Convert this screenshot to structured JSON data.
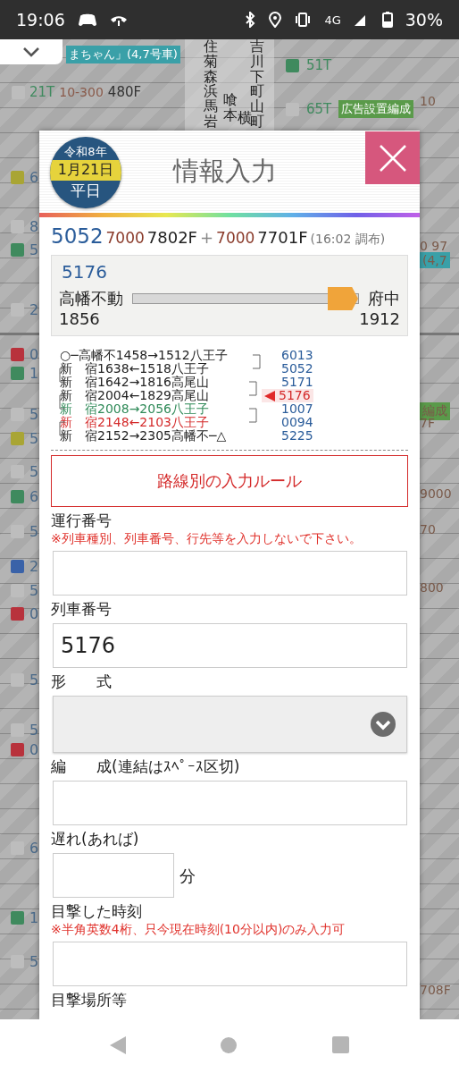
{
  "status_bar": {
    "time": "19:06",
    "network": "4G",
    "battery": "30%"
  },
  "background": {
    "top_badge": "まちゃん」(4,7号車)",
    "rows": [
      {
        "color": "#bdbdbd",
        "train": "21T",
        "series": "10-300",
        "formation": "480F"
      }
    ],
    "right_trains": [
      {
        "color": "#3f8a5e",
        "train": "51T"
      },
      {
        "color": "#bdbdbd",
        "train": "65T",
        "badge": "広告設置編成"
      }
    ],
    "station_columns": [
      "住菊森浜馬岩",
      "喰本",
      "横",
      "吉川下町山町"
    ],
    "left_marks": [
      {
        "color": "#a9a534",
        "text": "6"
      },
      {
        "color": "#bdbdbd",
        "text": "8"
      },
      {
        "color": "#3f8a5e",
        "text": "5"
      },
      {
        "color": "#bdbdbd",
        "text": "2"
      },
      {
        "color": "#b8323c",
        "text": "0"
      },
      {
        "color": "#3f8a5e",
        "text": "1"
      },
      {
        "color": "#bdbdbd",
        "text": "5"
      },
      {
        "color": "#a9a534",
        "text": "5"
      },
      {
        "color": "#bdbdbd",
        "text": "5"
      },
      {
        "color": "#3f8a5e",
        "text": "6"
      },
      {
        "color": "#bdbdbd",
        "text": "5"
      },
      {
        "color": "#3a62a8",
        "text": "2"
      },
      {
        "color": "#bdbdbd",
        "text": "5"
      },
      {
        "color": "#b8323c",
        "text": "0"
      },
      {
        "color": "#bdbdbd",
        "text": "5"
      },
      {
        "color": "#bdbdbd",
        "text": "5"
      },
      {
        "color": "#b8323c",
        "text": "0"
      },
      {
        "color": "#bdbdbd",
        "text": "6"
      },
      {
        "color": "#3f8a5e",
        "text": "1"
      },
      {
        "color": "#bdbdbd",
        "text": "5"
      }
    ],
    "right_texts": [
      {
        "kind": "plain",
        "text": "10"
      },
      {
        "kind": "plain",
        "text": "0 97"
      },
      {
        "kind": "teal",
        "text": "(4,7"
      },
      {
        "kind": "green",
        "text": "編成"
      },
      {
        "kind": "plain",
        "text": "7F"
      },
      {
        "kind": "plain",
        "text": "9000"
      },
      {
        "kind": "plain",
        "text": "70"
      },
      {
        "kind": "plain",
        "text": "800"
      },
      {
        "kind": "plain",
        "text": "708F"
      }
    ]
  },
  "dialog": {
    "era": "令和8年",
    "date": "1月21日",
    "day_type": "平日",
    "title": "情報入力",
    "train": {
      "number": "5052",
      "series1": "7000",
      "formation1": "7802F",
      "plus": "+",
      "series2": "7000",
      "formation2": "7701F",
      "note": "(16:02 調布)"
    },
    "progress": {
      "number": "5176",
      "from": "高幡不動",
      "to": "府中",
      "from_time": "1856",
      "to_time": "1912",
      "level": 1
    },
    "route": [
      {
        "kind": "normal",
        "text": "○─高幡不1458→1512八王子",
        "number": "6013",
        "current": false
      },
      {
        "kind": "normal",
        "text": "新　宿1638←1518八王子",
        "number": "5052",
        "current": false
      },
      {
        "kind": "normal",
        "text": "新　宿1642→1816高尾山",
        "number": "5171",
        "current": false
      },
      {
        "kind": "normal",
        "text": "新　宿2004←1829高尾山",
        "number": "5176",
        "current": true
      },
      {
        "kind": "green",
        "text": "新　宿2008→2056八王子",
        "number": "1007",
        "current": false
      },
      {
        "kind": "red",
        "text": "新　宿2148←2103八王子",
        "number": "0094",
        "current": false
      },
      {
        "kind": "normal",
        "text": "新　宿2152→2305高幡不─△",
        "number": "5225",
        "current": false
      }
    ],
    "rules_button": "路線別の入力ルール",
    "fields": [
      {
        "kind": "text",
        "label": "運行番号",
        "note": "※列車種別、列車番号、行先等を入力しないで下さい。"
      },
      {
        "kind": "text",
        "label": "列車番号",
        "value": "5176"
      },
      {
        "kind": "select",
        "label": "形　　式"
      },
      {
        "kind": "text",
        "label": "編　　成(連結はｽﾍﾟｰｽ区切)"
      },
      {
        "kind": "short",
        "label": "遅れ(あれば)",
        "unit": "分"
      },
      {
        "kind": "text",
        "label": "目撃した時刻",
        "note": "※半角英数4桁、只今現在時刻(10分以内)のみ入力可"
      },
      {
        "kind": "label",
        "label": "目撃場所等"
      }
    ]
  }
}
